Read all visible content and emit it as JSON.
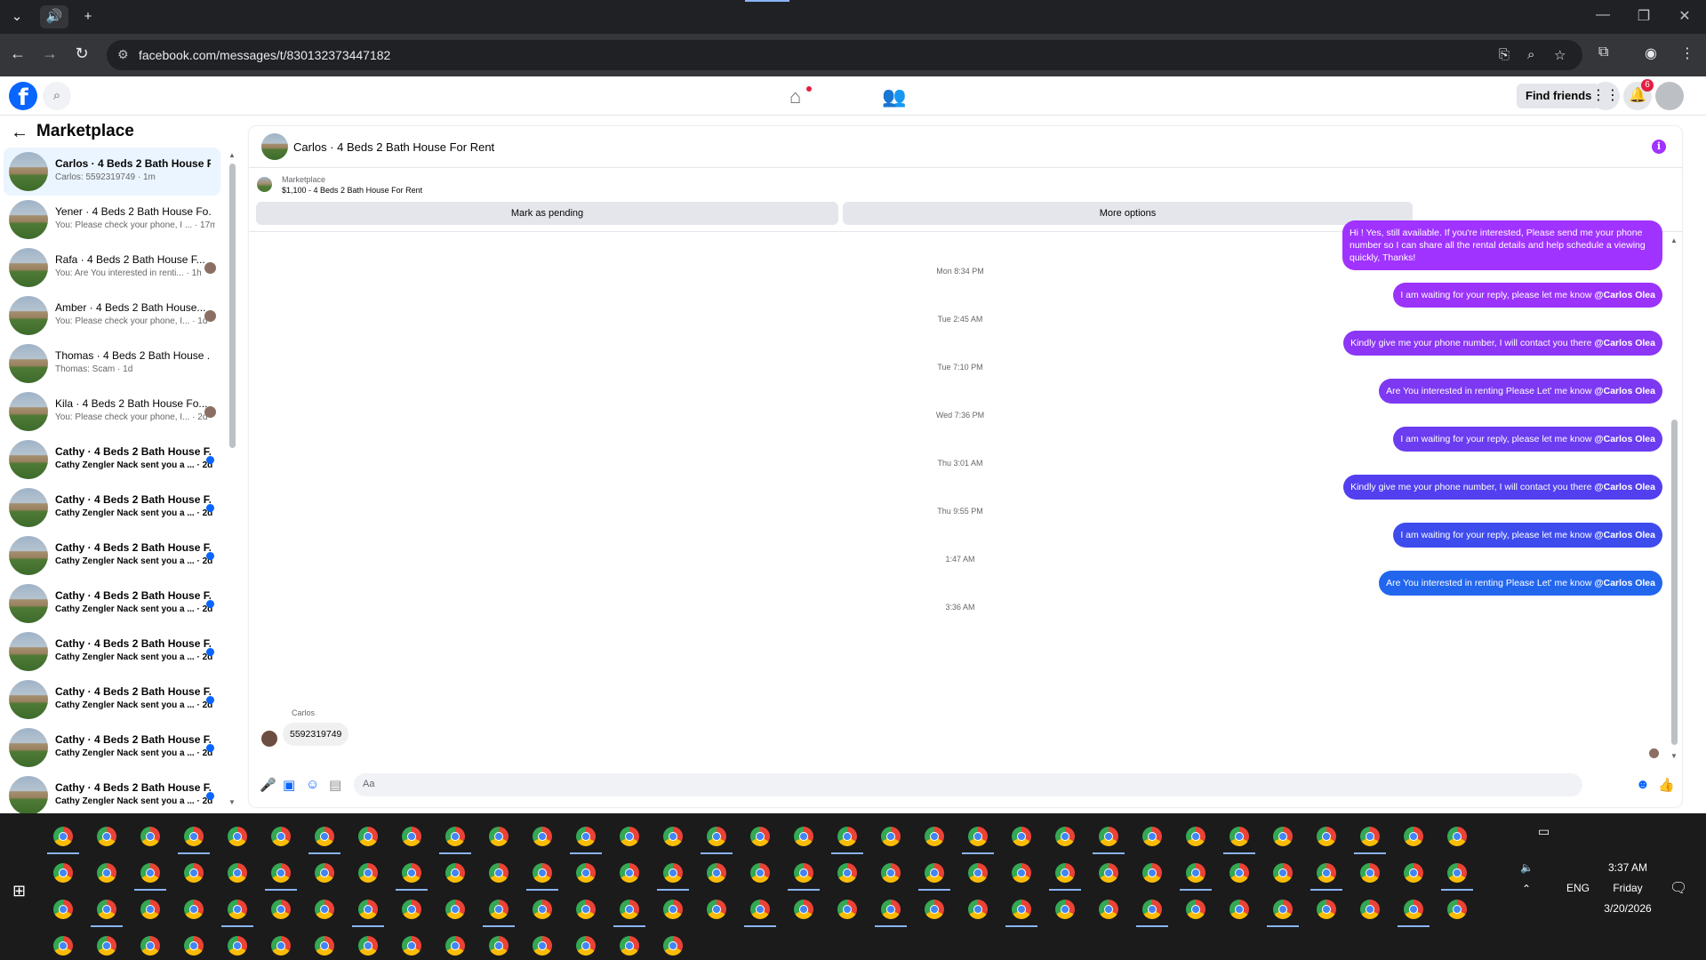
{
  "browser": {
    "url": "facebook.com/messages/t/830132373447182"
  },
  "header": {
    "find_friends": "Find friends",
    "notif_count": "6"
  },
  "sidebar": {
    "title": "Marketplace",
    "conversations": [
      {
        "name": "Carlos · 4 Beds 2 Bath House Fo...",
        "snippet": "Carlos: 5592319749 · 1m",
        "state": "active"
      },
      {
        "name": "Yener · 4 Beds 2 Bath House Fo...",
        "snippet": "You: Please check your phone, I ... · 17m",
        "state": "read"
      },
      {
        "name": "Rafa · 4 Beds 2 Bath House F...",
        "snippet": "You: Are You interested in renti... · 1h",
        "state": "seen"
      },
      {
        "name": "Amber · 4 Beds 2 Bath House...",
        "snippet": "You: Please check your phone, I... · 1d",
        "state": "seen"
      },
      {
        "name": "Thomas · 4 Beds 2 Bath House ...",
        "snippet": "Thomas: Scam · 1d",
        "state": "read"
      },
      {
        "name": "Kila · 4 Beds 2 Bath House Fo...",
        "snippet": "You: Please check your phone, I... · 2d",
        "state": "seen"
      },
      {
        "name": "Cathy · 4 Beds 2 Bath House F...",
        "snippet": "Cathy Zengler Nack sent you a ... · 2d",
        "state": "unread"
      },
      {
        "name": "Cathy · 4 Beds 2 Bath House F...",
        "snippet": "Cathy Zengler Nack sent you a ... · 2d",
        "state": "unread"
      },
      {
        "name": "Cathy · 4 Beds 2 Bath House F...",
        "snippet": "Cathy Zengler Nack sent you a ... · 2d",
        "state": "unread"
      },
      {
        "name": "Cathy · 4 Beds 2 Bath House F...",
        "snippet": "Cathy Zengler Nack sent you a ... · 2d",
        "state": "unread"
      },
      {
        "name": "Cathy · 4 Beds 2 Bath House F...",
        "snippet": "Cathy Zengler Nack sent you a ... · 2d",
        "state": "unread"
      },
      {
        "name": "Cathy · 4 Beds 2 Bath House F...",
        "snippet": "Cathy Zengler Nack sent you a ... · 2d",
        "state": "unread"
      },
      {
        "name": "Cathy · 4 Beds 2 Bath House F...",
        "snippet": "Cathy Zengler Nack sent you a ... · 2d",
        "state": "unread"
      },
      {
        "name": "Cathy · 4 Beds 2 Bath House F...",
        "snippet": "Cathy Zengler Nack sent you a ... · 2d",
        "state": "unread"
      }
    ]
  },
  "chat": {
    "title": "Carlos · 4 Beds 2 Bath House For Rent",
    "marketplace_label": "Marketplace",
    "listing": "$1,100 - 4 Beds 2 Bath House For Rent",
    "mark_pending": "Mark as pending",
    "more_options": "More options",
    "first_message": "Hi ! Yes, still available. If you're interested, Please send me your phone number so I can share all the rental details and help schedule a viewing quickly, Thanks!",
    "mention": "@Carlos Olea",
    "timeline": [
      {
        "time": "Mon 8:34 PM",
        "text": "I am waiting for your reply, please let me know"
      },
      {
        "time": "Tue 2:45 AM",
        "text": "Kindly give me your phone number, I will contact you there"
      },
      {
        "time": "Tue 7:10 PM",
        "text": "Are You  interested in renting Please Let' me know"
      },
      {
        "time": "Wed 7:36 PM",
        "text": "I am waiting for your reply, please let me know"
      },
      {
        "time": "Thu 3:01 AM",
        "text": "Kindly give me your phone number, I will contact you there"
      },
      {
        "time": "Thu 9:55 PM",
        "text": "I am waiting for your reply, please let me know"
      },
      {
        "time": "1:47 AM",
        "text": "Are You  interested in renting Please Let' me know"
      }
    ],
    "last_time": "3:36 AM",
    "incoming_sender": "Carlos",
    "incoming_text": "5592319749",
    "composer_placeholder": "Aa"
  },
  "taskbar": {
    "time": "3:37 AM",
    "day": "Friday",
    "date": "3/20/2026",
    "lang": "ENG"
  },
  "colors": {
    "bubble_top": "#a033ff",
    "bubble_mid": "#6b3cf0",
    "bubble_bottom": "#2266ee",
    "fb_blue": "#0866ff"
  }
}
